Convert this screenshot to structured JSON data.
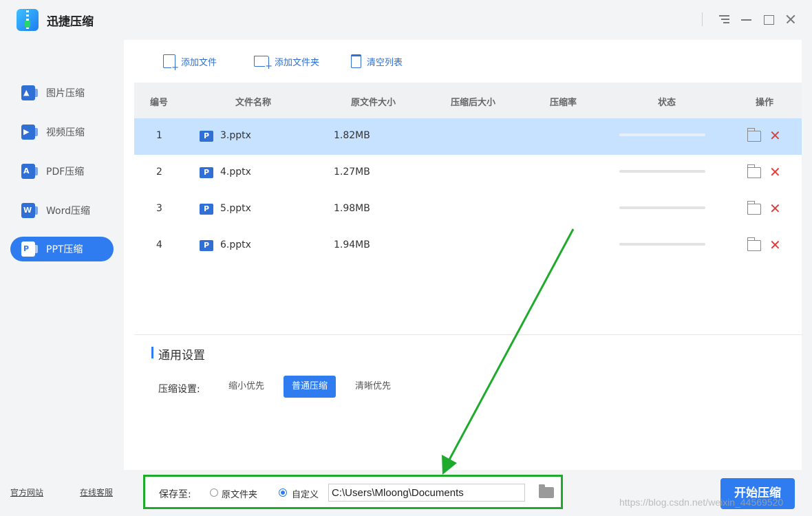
{
  "app": {
    "title": "迅捷压缩"
  },
  "sidebar": {
    "items": [
      {
        "label": "图片压缩",
        "icon": "image-icon"
      },
      {
        "label": "视频压缩",
        "icon": "video-icon"
      },
      {
        "label": "PDF压缩",
        "icon": "pdf-icon"
      },
      {
        "label": "Word压缩",
        "icon": "word-icon"
      },
      {
        "label": "PPT压缩",
        "icon": "ppt-icon",
        "active": true
      }
    ],
    "footer": {
      "website": "官方网站",
      "support": "在线客服"
    }
  },
  "toolbar": {
    "add_file": "添加文件",
    "add_folder": "添加文件夹",
    "clear_list": "清空列表"
  },
  "table": {
    "headers": [
      "编号",
      "文件名称",
      "原文件大小",
      "压缩后大小",
      "压缩率",
      "状态",
      "操作"
    ],
    "rows": [
      {
        "index": "1",
        "name": "3.pptx",
        "size": "1.82MB",
        "selected": true
      },
      {
        "index": "2",
        "name": "4.pptx",
        "size": "1.27MB"
      },
      {
        "index": "3",
        "name": "5.pptx",
        "size": "1.98MB"
      },
      {
        "index": "4",
        "name": "6.pptx",
        "size": "1.94MB"
      }
    ],
    "file_badge": "P"
  },
  "settings": {
    "title": "通用设置",
    "compress_label": "压缩设置:",
    "options": [
      "缩小优先",
      "普通压缩",
      "清晰优先"
    ],
    "selected_option": "普通压缩"
  },
  "save": {
    "label": "保存至:",
    "option_original": "原文件夹",
    "option_custom": "自定义",
    "selected": "自定义",
    "path": "C:\\Users\\Mloong\\Documents"
  },
  "start_button": "开始压缩",
  "watermark": "https://blog.csdn.net/weixin_44569520",
  "colors": {
    "accent": "#2f7cf0",
    "highlight_row": "#c6e2ff",
    "delete": "#e23c3c",
    "annotation_arrow": "#1eaa2a"
  }
}
